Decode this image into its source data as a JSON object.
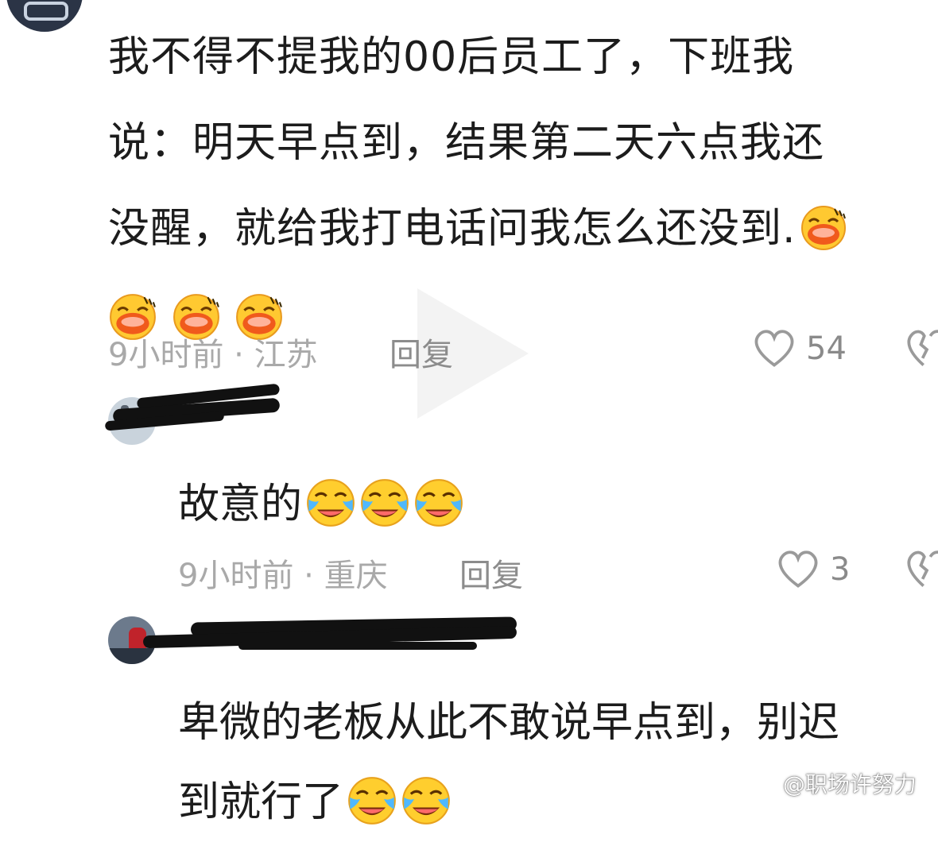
{
  "comment1": {
    "lines": [
      "我不得不提我的00后员工了，下班我",
      "说：明天早点到，结果第二天六点我还",
      "没醒，就给我打电话问我怎么还没到."
    ],
    "meta": "9小时前 · 江苏",
    "reply_label": "回复",
    "likes": "54",
    "emojis": [
      "laugh-sweat",
      "laugh-sweat",
      "laugh-sweat",
      "laugh-sweat"
    ]
  },
  "reply1": {
    "text": "故意的",
    "meta": "9小时前 · 重庆",
    "reply_label": "回复",
    "likes": "3",
    "emojis": [
      "crying-laughing",
      "crying-laughing",
      "crying-laughing"
    ]
  },
  "reply2": {
    "lines": [
      "卑微的老板从此不敢说早点到，别迟",
      "到就行了"
    ],
    "emojis": [
      "crying-laughing",
      "crying-laughing"
    ]
  },
  "watermark": {
    "text": "@职场许努力"
  },
  "colors": {
    "meta_gray": "#a9a9a9",
    "text": "#1c1c1c",
    "emoji_yellow": "#ffc52e",
    "emoji_orange": "#f08a28"
  }
}
